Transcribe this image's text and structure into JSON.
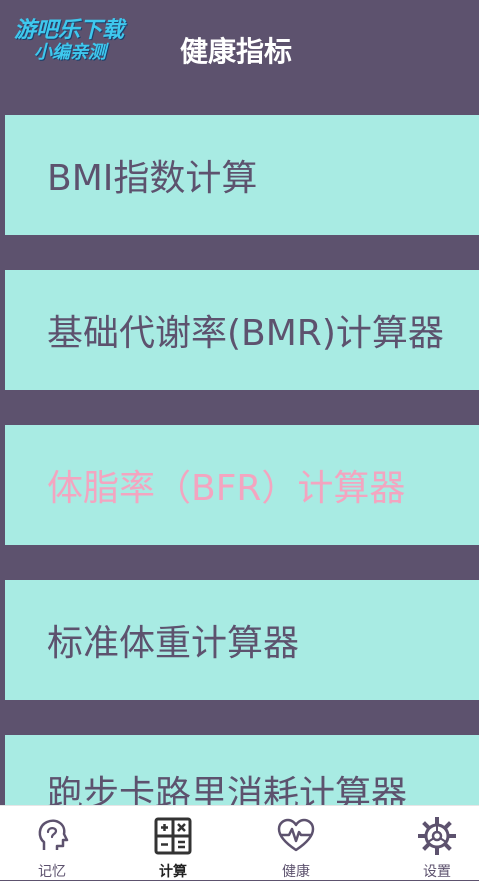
{
  "header": {
    "logo_line1": "游吧乐下载",
    "logo_line2": "小编亲测",
    "title": "健康指标"
  },
  "menu": {
    "items": [
      {
        "label": "BMI指数计算"
      },
      {
        "label": "基础代谢率(BMR)计算器"
      },
      {
        "label": "体脂率（BFR）计算器"
      },
      {
        "label": "标准体重计算器"
      },
      {
        "label": "跑步卡路里消耗计算器"
      }
    ]
  },
  "tabbar": {
    "tabs": [
      {
        "label": "记忆",
        "icon": "brain-head-icon"
      },
      {
        "label": "计算",
        "icon": "calculator-icon"
      },
      {
        "label": "健康",
        "icon": "heart-pulse-icon"
      },
      {
        "label": "设置",
        "icon": "gear-icon"
      }
    ],
    "selected": "计算"
  },
  "colors": {
    "background": "#5d526e",
    "card": "#a8ebe3",
    "active_text": "#f3a5c0",
    "text": "#5d526e"
  }
}
